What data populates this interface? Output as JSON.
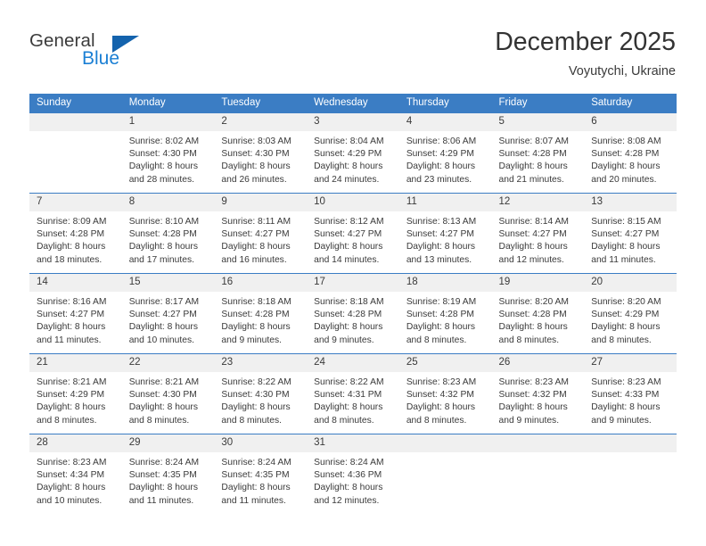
{
  "brand": {
    "name_part1": "General",
    "name_part2": "Blue",
    "triangle_icon": "triangle-icon",
    "colors": {
      "general_text": "#3b3b3b",
      "blue_text": "#1a7fd4",
      "triangle": "#1463ad"
    }
  },
  "header": {
    "title": "December 2025",
    "subtitle": "Voyutychi, Ukraine"
  },
  "calendar": {
    "header_background": "#3b7dc4",
    "daynum_background": "#f0f0f0",
    "weekdays": [
      "Sunday",
      "Monday",
      "Tuesday",
      "Wednesday",
      "Thursday",
      "Friday",
      "Saturday"
    ],
    "weeks": [
      [
        {
          "day": "",
          "sunrise": "",
          "sunset": "",
          "daylight1": "",
          "daylight2": "",
          "empty": true
        },
        {
          "day": "1",
          "sunrise": "Sunrise: 8:02 AM",
          "sunset": "Sunset: 4:30 PM",
          "daylight1": "Daylight: 8 hours",
          "daylight2": "and 28 minutes."
        },
        {
          "day": "2",
          "sunrise": "Sunrise: 8:03 AM",
          "sunset": "Sunset: 4:30 PM",
          "daylight1": "Daylight: 8 hours",
          "daylight2": "and 26 minutes."
        },
        {
          "day": "3",
          "sunrise": "Sunrise: 8:04 AM",
          "sunset": "Sunset: 4:29 PM",
          "daylight1": "Daylight: 8 hours",
          "daylight2": "and 24 minutes."
        },
        {
          "day": "4",
          "sunrise": "Sunrise: 8:06 AM",
          "sunset": "Sunset: 4:29 PM",
          "daylight1": "Daylight: 8 hours",
          "daylight2": "and 23 minutes."
        },
        {
          "day": "5",
          "sunrise": "Sunrise: 8:07 AM",
          "sunset": "Sunset: 4:28 PM",
          "daylight1": "Daylight: 8 hours",
          "daylight2": "and 21 minutes."
        },
        {
          "day": "6",
          "sunrise": "Sunrise: 8:08 AM",
          "sunset": "Sunset: 4:28 PM",
          "daylight1": "Daylight: 8 hours",
          "daylight2": "and 20 minutes."
        }
      ],
      [
        {
          "day": "7",
          "sunrise": "Sunrise: 8:09 AM",
          "sunset": "Sunset: 4:28 PM",
          "daylight1": "Daylight: 8 hours",
          "daylight2": "and 18 minutes."
        },
        {
          "day": "8",
          "sunrise": "Sunrise: 8:10 AM",
          "sunset": "Sunset: 4:28 PM",
          "daylight1": "Daylight: 8 hours",
          "daylight2": "and 17 minutes."
        },
        {
          "day": "9",
          "sunrise": "Sunrise: 8:11 AM",
          "sunset": "Sunset: 4:27 PM",
          "daylight1": "Daylight: 8 hours",
          "daylight2": "and 16 minutes."
        },
        {
          "day": "10",
          "sunrise": "Sunrise: 8:12 AM",
          "sunset": "Sunset: 4:27 PM",
          "daylight1": "Daylight: 8 hours",
          "daylight2": "and 14 minutes."
        },
        {
          "day": "11",
          "sunrise": "Sunrise: 8:13 AM",
          "sunset": "Sunset: 4:27 PM",
          "daylight1": "Daylight: 8 hours",
          "daylight2": "and 13 minutes."
        },
        {
          "day": "12",
          "sunrise": "Sunrise: 8:14 AM",
          "sunset": "Sunset: 4:27 PM",
          "daylight1": "Daylight: 8 hours",
          "daylight2": "and 12 minutes."
        },
        {
          "day": "13",
          "sunrise": "Sunrise: 8:15 AM",
          "sunset": "Sunset: 4:27 PM",
          "daylight1": "Daylight: 8 hours",
          "daylight2": "and 11 minutes."
        }
      ],
      [
        {
          "day": "14",
          "sunrise": "Sunrise: 8:16 AM",
          "sunset": "Sunset: 4:27 PM",
          "daylight1": "Daylight: 8 hours",
          "daylight2": "and 11 minutes."
        },
        {
          "day": "15",
          "sunrise": "Sunrise: 8:17 AM",
          "sunset": "Sunset: 4:27 PM",
          "daylight1": "Daylight: 8 hours",
          "daylight2": "and 10 minutes."
        },
        {
          "day": "16",
          "sunrise": "Sunrise: 8:18 AM",
          "sunset": "Sunset: 4:28 PM",
          "daylight1": "Daylight: 8 hours",
          "daylight2": "and 9 minutes."
        },
        {
          "day": "17",
          "sunrise": "Sunrise: 8:18 AM",
          "sunset": "Sunset: 4:28 PM",
          "daylight1": "Daylight: 8 hours",
          "daylight2": "and 9 minutes."
        },
        {
          "day": "18",
          "sunrise": "Sunrise: 8:19 AM",
          "sunset": "Sunset: 4:28 PM",
          "daylight1": "Daylight: 8 hours",
          "daylight2": "and 8 minutes."
        },
        {
          "day": "19",
          "sunrise": "Sunrise: 8:20 AM",
          "sunset": "Sunset: 4:28 PM",
          "daylight1": "Daylight: 8 hours",
          "daylight2": "and 8 minutes."
        },
        {
          "day": "20",
          "sunrise": "Sunrise: 8:20 AM",
          "sunset": "Sunset: 4:29 PM",
          "daylight1": "Daylight: 8 hours",
          "daylight2": "and 8 minutes."
        }
      ],
      [
        {
          "day": "21",
          "sunrise": "Sunrise: 8:21 AM",
          "sunset": "Sunset: 4:29 PM",
          "daylight1": "Daylight: 8 hours",
          "daylight2": "and 8 minutes."
        },
        {
          "day": "22",
          "sunrise": "Sunrise: 8:21 AM",
          "sunset": "Sunset: 4:30 PM",
          "daylight1": "Daylight: 8 hours",
          "daylight2": "and 8 minutes."
        },
        {
          "day": "23",
          "sunrise": "Sunrise: 8:22 AM",
          "sunset": "Sunset: 4:30 PM",
          "daylight1": "Daylight: 8 hours",
          "daylight2": "and 8 minutes."
        },
        {
          "day": "24",
          "sunrise": "Sunrise: 8:22 AM",
          "sunset": "Sunset: 4:31 PM",
          "daylight1": "Daylight: 8 hours",
          "daylight2": "and 8 minutes."
        },
        {
          "day": "25",
          "sunrise": "Sunrise: 8:23 AM",
          "sunset": "Sunset: 4:32 PM",
          "daylight1": "Daylight: 8 hours",
          "daylight2": "and 8 minutes."
        },
        {
          "day": "26",
          "sunrise": "Sunrise: 8:23 AM",
          "sunset": "Sunset: 4:32 PM",
          "daylight1": "Daylight: 8 hours",
          "daylight2": "and 9 minutes."
        },
        {
          "day": "27",
          "sunrise": "Sunrise: 8:23 AM",
          "sunset": "Sunset: 4:33 PM",
          "daylight1": "Daylight: 8 hours",
          "daylight2": "and 9 minutes."
        }
      ],
      [
        {
          "day": "28",
          "sunrise": "Sunrise: 8:23 AM",
          "sunset": "Sunset: 4:34 PM",
          "daylight1": "Daylight: 8 hours",
          "daylight2": "and 10 minutes."
        },
        {
          "day": "29",
          "sunrise": "Sunrise: 8:24 AM",
          "sunset": "Sunset: 4:35 PM",
          "daylight1": "Daylight: 8 hours",
          "daylight2": "and 11 minutes."
        },
        {
          "day": "30",
          "sunrise": "Sunrise: 8:24 AM",
          "sunset": "Sunset: 4:35 PM",
          "daylight1": "Daylight: 8 hours",
          "daylight2": "and 11 minutes."
        },
        {
          "day": "31",
          "sunrise": "Sunrise: 8:24 AM",
          "sunset": "Sunset: 4:36 PM",
          "daylight1": "Daylight: 8 hours",
          "daylight2": "and 12 minutes."
        },
        {
          "day": "",
          "sunrise": "",
          "sunset": "",
          "daylight1": "",
          "daylight2": "",
          "empty": true
        },
        {
          "day": "",
          "sunrise": "",
          "sunset": "",
          "daylight1": "",
          "daylight2": "",
          "empty": true
        },
        {
          "day": "",
          "sunrise": "",
          "sunset": "",
          "daylight1": "",
          "daylight2": "",
          "empty": true
        }
      ]
    ]
  }
}
